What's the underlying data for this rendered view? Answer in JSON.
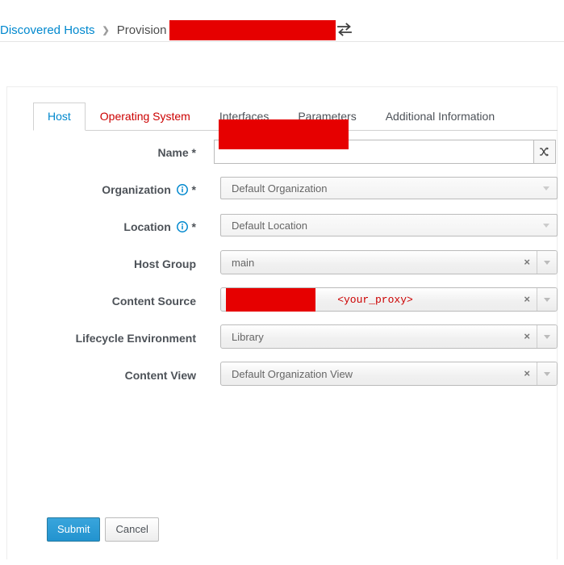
{
  "breadcrumb": {
    "root_label": "Discovered Hosts",
    "separator": "❯",
    "current_label": "Provision",
    "redacted_value": "",
    "swap_icon": "exchange-arrows-icon"
  },
  "tabs": [
    {
      "label": "Host",
      "state": "active"
    },
    {
      "label": "Operating System",
      "state": "error"
    },
    {
      "label": "Interfaces",
      "state": "normal"
    },
    {
      "label": "Parameters",
      "state": "normal"
    },
    {
      "label": "Additional Information",
      "state": "normal"
    }
  ],
  "form": {
    "name": {
      "label": "Name",
      "required_marker": "*",
      "value": "",
      "redacted": true,
      "addon_icon": "shuffle-icon"
    },
    "organization": {
      "label": "Organization",
      "required_marker": "*",
      "info_icon": "info-circle-icon",
      "value": "Default Organization"
    },
    "location": {
      "label": "Location",
      "required_marker": "*",
      "info_icon": "info-circle-icon",
      "value": "Default Location"
    },
    "host_group": {
      "label": "Host Group",
      "value": "main",
      "clear_label": "×"
    },
    "content_source": {
      "label": "Content Source",
      "value": "<your_proxy>",
      "redacted": true,
      "clear_label": "×"
    },
    "lifecycle_environment": {
      "label": "Lifecycle Environment",
      "value": "Library",
      "clear_label": "×"
    },
    "content_view": {
      "label": "Content View",
      "value": "Default Organization View",
      "clear_label": "×"
    }
  },
  "actions": {
    "submit_label": "Submit",
    "cancel_label": "Cancel"
  },
  "colors": {
    "link": "#0088ce",
    "error": "#cc0000",
    "redaction": "#e60000",
    "primary_button": "#2293cf"
  }
}
